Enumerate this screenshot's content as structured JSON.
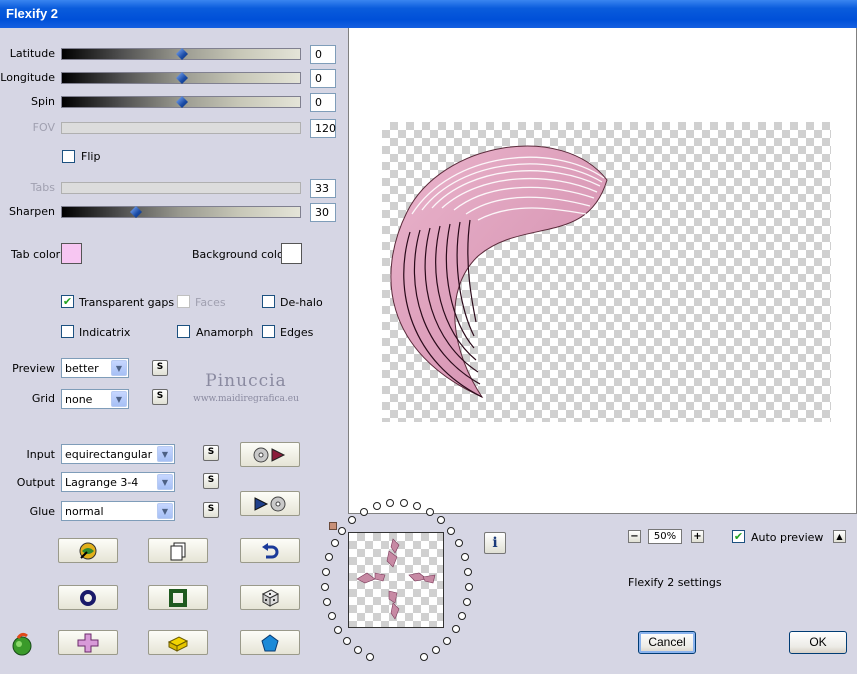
{
  "window": {
    "title": "Flexify 2"
  },
  "sliders": {
    "latitude": {
      "label": "Latitude",
      "value": "0",
      "position": 0.5
    },
    "longitude": {
      "label": "Longitude",
      "value": "0",
      "position": 0.5
    },
    "spin": {
      "label": "Spin",
      "value": "0",
      "position": 0.5
    },
    "fov": {
      "label": "FOV",
      "value": "120"
    },
    "tabs": {
      "label": "Tabs",
      "value": "33"
    },
    "sharpen": {
      "label": "Sharpen",
      "value": "30",
      "position": 0.3
    }
  },
  "flip": {
    "label": "Flip",
    "checked": false
  },
  "colors": {
    "tab_color_label": "Tab color",
    "tab_color": "#f7c6f2",
    "background_color_label": "Background color",
    "background_color": "#ffffff"
  },
  "options": {
    "transparent_gaps": {
      "label": "Transparent gaps",
      "checked": true
    },
    "faces": {
      "label": "Faces",
      "checked": false
    },
    "de_halo": {
      "label": "De-halo",
      "checked": false
    },
    "indicatrix": {
      "label": "Indicatrix",
      "checked": false
    },
    "anamorph": {
      "label": "Anamorph",
      "checked": false
    },
    "edges": {
      "label": "Edges",
      "checked": false
    }
  },
  "selects": {
    "preview": {
      "label": "Preview",
      "value": "better",
      "s": "S"
    },
    "grid": {
      "label": "Grid",
      "value": "none",
      "s": "S"
    },
    "input": {
      "label": "Input",
      "value": "equirectangular",
      "s": "S"
    },
    "output": {
      "label": "Output",
      "value": "Lagrange 3-4",
      "s": "S"
    },
    "glue": {
      "label": "Glue",
      "value": "normal",
      "s": "S"
    }
  },
  "watermark": {
    "line1": "Pinuccia",
    "line2": "www.maidiregrafica.eu"
  },
  "zoom": {
    "minus": "−",
    "value": "50%",
    "plus": "+"
  },
  "auto_preview": {
    "label": "Auto preview",
    "checked": true,
    "arrow": "▲"
  },
  "settings_name": "Flexify 2 settings",
  "buttons": {
    "cancel": "Cancel",
    "ok": "OK",
    "info": "i"
  },
  "accent": {
    "title_blue": "#0a5cdc",
    "shape_pink": "#dea0bc"
  }
}
